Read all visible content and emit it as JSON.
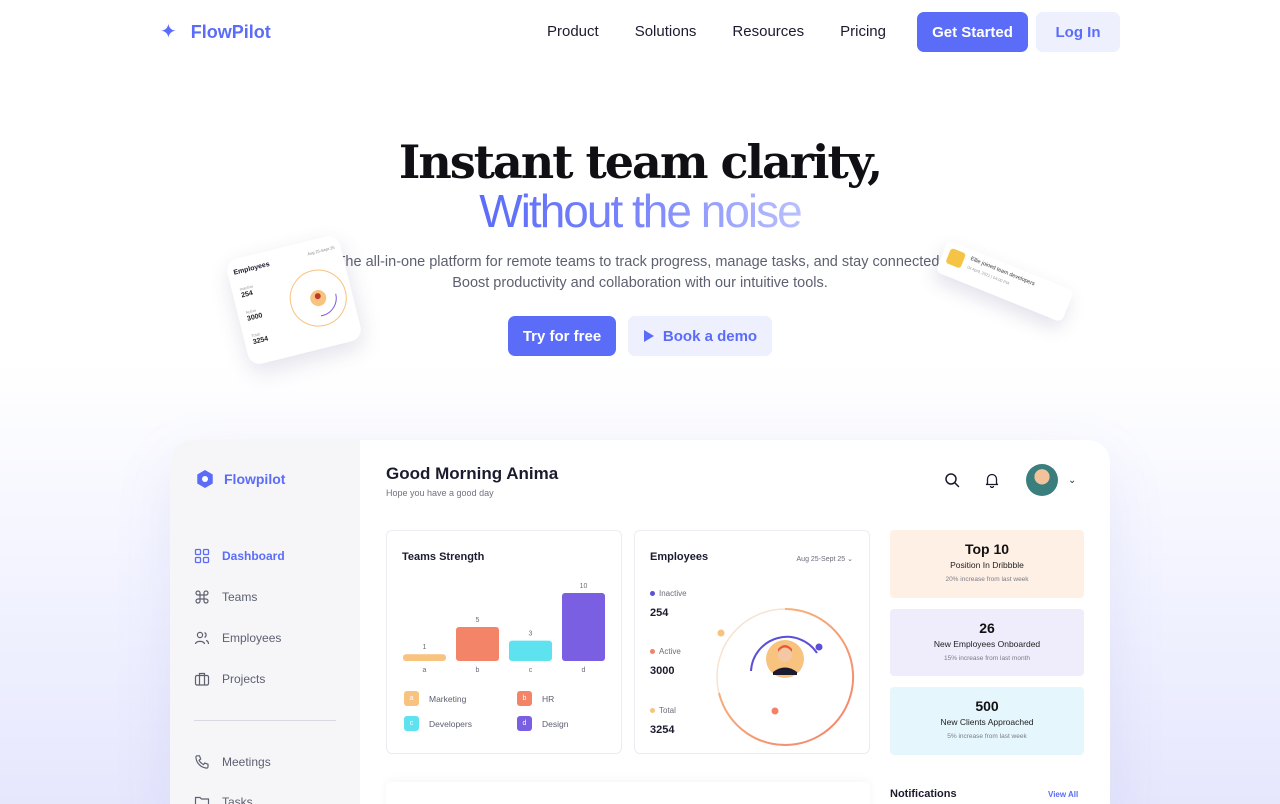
{
  "nav": {
    "brand": "FlowPilot",
    "links": [
      "Product",
      "Solutions",
      "Resources",
      "Pricing"
    ],
    "get_started": "Get Started",
    "login": "Log In"
  },
  "hero": {
    "title": "Instant team clarity,",
    "subtitle": "Without the noise",
    "desc_line1": "The all-in-one platform for remote teams to track progress, manage tasks, and stay connected.",
    "desc_line2": "Boost productivity and collaboration with our intuitive tools.",
    "try": "Try for free",
    "demo": "Book a demo"
  },
  "float_left": {
    "title": "Employees",
    "date": "Aug 25-Sept 25",
    "stats": [
      {
        "label": "Inactive",
        "value": "254"
      },
      {
        "label": "Active",
        "value": "3000"
      },
      {
        "label": "Total",
        "value": "3254"
      }
    ]
  },
  "float_right": {
    "text": "Ellie joined team developers",
    "sub": "04 April, 2021 | 04:00 PM"
  },
  "dashboard": {
    "brand": "Flowpilot",
    "sidebar": [
      {
        "label": "Dashboard",
        "icon": "grid-icon"
      },
      {
        "label": "Teams",
        "icon": "command-icon"
      },
      {
        "label": "Employees",
        "icon": "users-icon"
      },
      {
        "label": "Projects",
        "icon": "briefcase-icon"
      },
      {
        "label": "Meetings",
        "icon": "phone-icon"
      },
      {
        "label": "Tasks",
        "icon": "folder-icon"
      }
    ],
    "greeting": "Good Morning Anima",
    "greeting_sub": "Hope you have a good day",
    "teams": {
      "title": "Teams Strength",
      "legend": [
        {
          "key": "a",
          "label": "Marketing",
          "color": "#f8c27f"
        },
        {
          "key": "b",
          "label": "HR",
          "color": "#f38468"
        },
        {
          "key": "c",
          "label": "Developers",
          "color": "#5fe2ef"
        },
        {
          "key": "d",
          "label": "Design",
          "color": "#7a5fe3"
        }
      ]
    },
    "employees": {
      "title": "Employees",
      "date": "Aug 25-Sept 25",
      "stats": [
        {
          "label": "Inactive",
          "value": "254",
          "color": "#5b4fd6"
        },
        {
          "label": "Active",
          "value": "3000",
          "color": "#f3816a"
        },
        {
          "label": "Total",
          "value": "3254",
          "color": "#f8c27f"
        }
      ]
    },
    "kpis": [
      {
        "num": "Top 10",
        "label": "Position In Dribbble",
        "sub": "20% increase from last week",
        "bg": "#fff0e6"
      },
      {
        "num": "26",
        "label": "New Employees Onboarded",
        "sub": "15% increase from last month",
        "bg": "#efecfc"
      },
      {
        "num": "500",
        "label": "New Clients Approached",
        "sub": "5% increase from last week",
        "bg": "#e6f6fd"
      }
    ],
    "notifications": "Notifications",
    "view_all": "View All"
  },
  "chart_data": {
    "type": "bar",
    "categories": [
      "a",
      "b",
      "c",
      "d"
    ],
    "values": [
      1,
      5,
      3,
      10
    ],
    "title": "Teams Strength",
    "ylim": [
      0,
      10
    ],
    "colors": [
      "#f8c27f",
      "#f38468",
      "#5fe2ef",
      "#7a5fe3"
    ]
  }
}
